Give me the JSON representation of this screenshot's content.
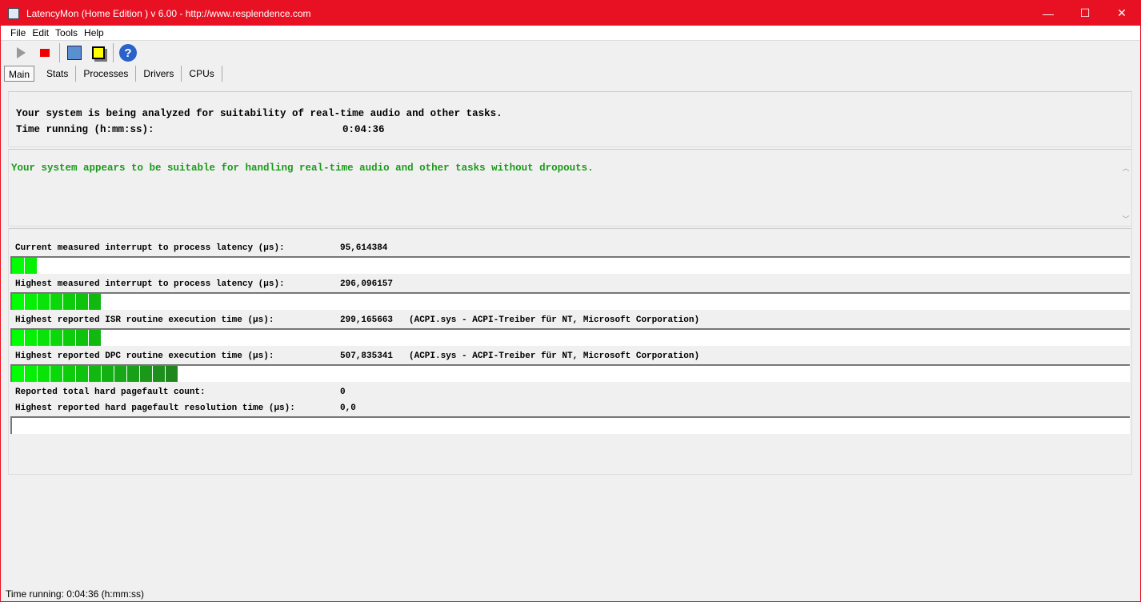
{
  "window": {
    "title": "LatencyMon  (Home Edition )  v 6.00 - http://www.resplendence.com",
    "minimize": "—",
    "maximize": "☐",
    "close": "✕"
  },
  "menu": [
    "File",
    "Edit",
    "Tools",
    "Help"
  ],
  "tabs": [
    "Main",
    "Stats",
    "Processes",
    "Drivers",
    "CPUs"
  ],
  "status_panel": {
    "line1": "Your system is being analyzed for suitability of real-time audio and other tasks.",
    "time_label": "Time running (h:mm:ss):",
    "time_value": "0:04:36"
  },
  "verdict": "Your system appears to be suitable for handling real-time audio and other tasks without dropouts.",
  "metrics": [
    {
      "label": "Current measured interrupt to process latency (µs):",
      "value": "95,614384",
      "detail": "",
      "segments": 2
    },
    {
      "label": "Highest measured interrupt to process latency (µs):",
      "value": "296,096157",
      "detail": "",
      "segments": 7
    },
    {
      "label": "Highest reported ISR routine execution time (µs):",
      "value": "299,165663",
      "detail": "(ACPI.sys - ACPI-Treiber für NT, Microsoft Corporation)",
      "segments": 7
    },
    {
      "label": "Highest reported DPC routine execution time (µs):",
      "value": "507,835341",
      "detail": "(ACPI.sys - ACPI-Treiber für NT, Microsoft Corporation)",
      "segments": 13
    }
  ],
  "pagefault": {
    "count_label": "Reported total hard pagefault count:",
    "count_value": "0",
    "res_label": "Highest reported hard pagefault resolution time (µs):",
    "res_value": "0,0",
    "segments": 0
  },
  "statusbar": "Time running: 0:04:36  (h:mm:ss)"
}
